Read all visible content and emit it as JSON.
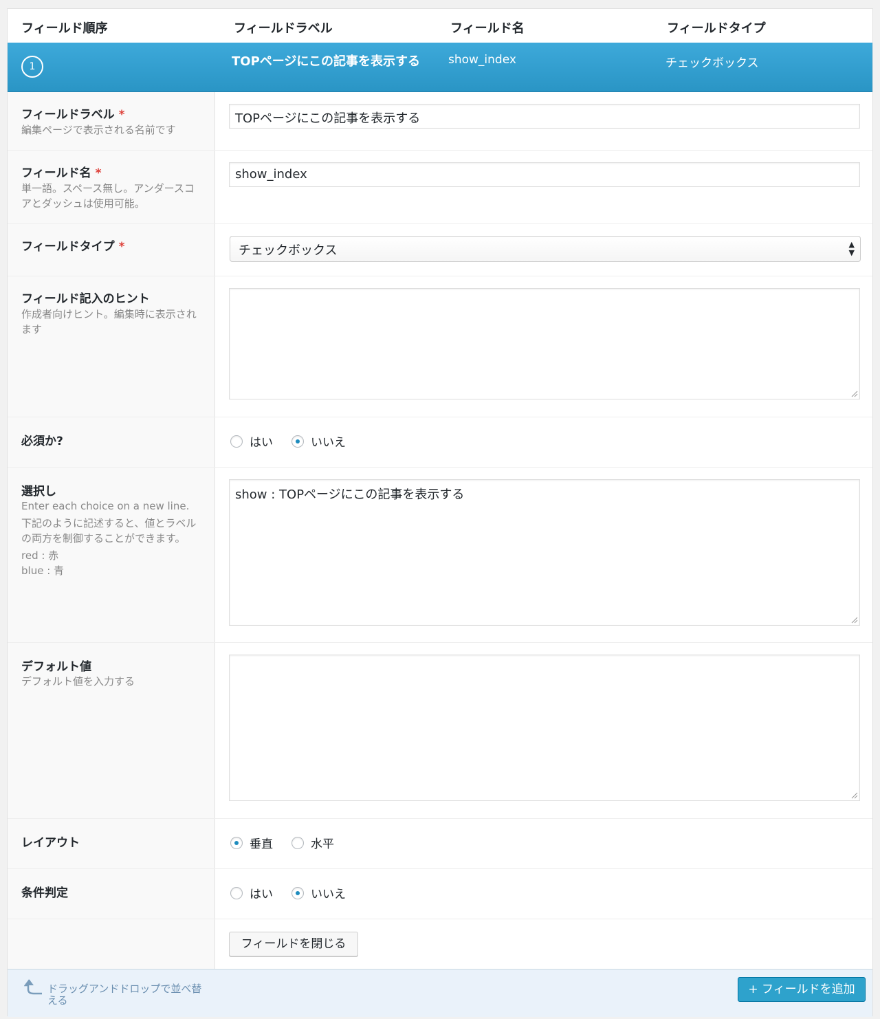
{
  "header": {
    "col_order": "フィールド順序",
    "col_label": "フィールドラベル",
    "col_name": "フィールド名",
    "col_type": "フィールドタイプ"
  },
  "field_bar": {
    "order": "1",
    "label": "TOPページにこの記事を表示する",
    "name": "show_index",
    "type": "チェックボックス"
  },
  "rows": {
    "label": {
      "title": "フィールドラベル",
      "required": "*",
      "desc": "編集ページで表示される名前です",
      "value": "TOPページにこの記事を表示する"
    },
    "name": {
      "title": "フィールド名",
      "required": "*",
      "desc": "単一語。スペース無し。アンダースコアとダッシュは使用可能。",
      "value": "show_index"
    },
    "type": {
      "title": "フィールドタイプ",
      "required": "*",
      "value": "チェックボックス"
    },
    "hint": {
      "title": "フィールド記入のヒント",
      "desc": "作成者向けヒント。編集時に表示されます",
      "value": ""
    },
    "required": {
      "title": "必須か?",
      "opt_yes": "はい",
      "opt_no": "いいえ",
      "selected": "いいえ"
    },
    "choices": {
      "title": "選択し",
      "desc1": "Enter each choice on a new line.",
      "desc2": "下記のように記述すると、値とラベルの両方を制御することができます。",
      "ex1": "red : 赤",
      "ex2": "blue : 青",
      "value": "show : TOPページにこの記事を表示する"
    },
    "default": {
      "title": "デフォルト値",
      "desc": "デフォルト値を入力する",
      "value": ""
    },
    "layout": {
      "title": "レイアウト",
      "opt_vertical": "垂直",
      "opt_horizontal": "水平",
      "selected": "垂直"
    },
    "conditional": {
      "title": "条件判定",
      "opt_yes": "はい",
      "opt_no": "いいえ",
      "selected": "いいえ"
    },
    "close_button": "フィールドを閉じる"
  },
  "footer": {
    "hint": "ドラッグアンドドロップで並べ替える",
    "add_button": "+ フィールドを追加"
  },
  "colors": {
    "accent": "#2ea2cc",
    "bar": "#3da9da",
    "required": "#dd3d36"
  }
}
